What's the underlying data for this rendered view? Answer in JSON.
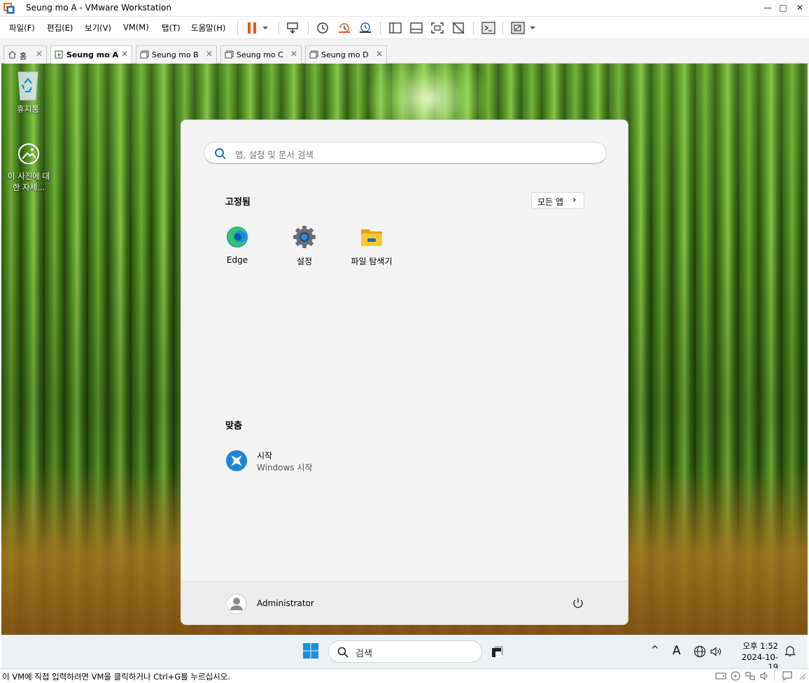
{
  "window": {
    "title": "Seung mo A - VMware Workstation",
    "controls": {
      "minimize": "—",
      "maximize": "□",
      "close": "✕"
    }
  },
  "menu": {
    "items": [
      "파일(F)",
      "편집(E)",
      "보기(V)",
      "VM(M)",
      "탭(T)",
      "도움말(H)"
    ]
  },
  "tabs": [
    {
      "label": "홈",
      "icon": "home-icon",
      "active": false
    },
    {
      "label": "Seung mo A",
      "icon": "vm-running-icon",
      "active": true
    },
    {
      "label": "Seung mo B",
      "icon": "vm-icon",
      "active": false
    },
    {
      "label": "Seung mo C",
      "icon": "vm-icon",
      "active": false
    },
    {
      "label": "Seung mo D",
      "icon": "vm-icon",
      "active": false
    }
  ],
  "tab_close": "✕",
  "desktop": {
    "icons": [
      {
        "label": "휴지통",
        "icon": "recycle-bin-icon"
      },
      {
        "label": "이 사진에 대한 자세...",
        "icon": "learn-about-picture-icon"
      }
    ]
  },
  "start_menu": {
    "search_placeholder": "앱, 설정 및 문서 검색",
    "pinned_title": "고정됨",
    "all_apps_label": "모든 앱",
    "all_apps_chevron": "›",
    "pinned_apps": [
      {
        "label": "Edge",
        "icon": "edge-icon"
      },
      {
        "label": "설정",
        "icon": "settings-gear-icon"
      },
      {
        "label": "파일 탐색기",
        "icon": "file-explorer-icon"
      }
    ],
    "recommended_title": "맞춤",
    "recommended": [
      {
        "title": "시작",
        "subtitle": "Windows 시작",
        "icon": "get-started-icon"
      }
    ],
    "user_name": "Administrator",
    "power_icon": "power-icon"
  },
  "taskbar": {
    "search_label": "검색",
    "tray": {
      "chevron": "^",
      "ime": "A",
      "time": "오후 1:52",
      "date": "2024-10-19"
    }
  },
  "statusbar": {
    "message": "이 VM에 직접 입력하려면 VM을 클릭하거나 Ctrl+G를 누르십시오."
  },
  "colors": {
    "accent": "#0067c0",
    "vmware_orange": "#f36f21",
    "pause_orange": "#e8590c"
  }
}
